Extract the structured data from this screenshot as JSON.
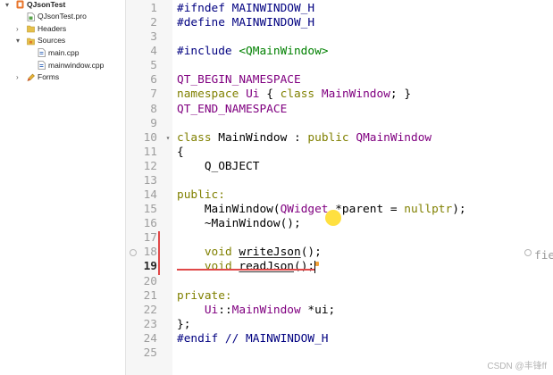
{
  "project_tree": {
    "items": [
      {
        "label": "QJsonTest",
        "depth": 0,
        "expander": "▾",
        "icon": "qt-project-icon",
        "bold": true
      },
      {
        "label": "QJsonTest.pro",
        "depth": 1,
        "icon": "pro-file-icon"
      },
      {
        "label": "Headers",
        "depth": 1,
        "expander": "›",
        "icon": "headers-folder-icon"
      },
      {
        "label": "Sources",
        "depth": 1,
        "expander": "▾",
        "icon": "sources-folder-icon"
      },
      {
        "label": "main.cpp",
        "depth": 2,
        "icon": "cpp-file-icon"
      },
      {
        "label": "mainwindow.cpp",
        "depth": 2,
        "icon": "cpp-file-icon"
      },
      {
        "label": "Forms",
        "depth": 1,
        "expander": "›",
        "icon": "forms-folder-icon"
      }
    ]
  },
  "editor": {
    "lines": [
      {
        "n": "1",
        "tokens": [
          {
            "t": "#ifndef MAINWINDOW_H",
            "color": "#000080"
          }
        ]
      },
      {
        "n": "2",
        "tokens": [
          {
            "t": "#define MAINWINDOW_H",
            "color": "#000080"
          }
        ]
      },
      {
        "n": "3",
        "tokens": []
      },
      {
        "n": "4",
        "tokens": [
          {
            "t": "#include ",
            "color": "#000080"
          },
          {
            "t": "<QMainWindow>",
            "color": "#008000"
          }
        ]
      },
      {
        "n": "5",
        "tokens": []
      },
      {
        "n": "6",
        "tokens": [
          {
            "t": "QT_BEGIN_NAMESPACE",
            "color": "#800080"
          }
        ]
      },
      {
        "n": "7",
        "tokens": [
          {
            "t": "namespace",
            "color": "#808000"
          },
          {
            "t": " "
          },
          {
            "t": "Ui",
            "color": "#800080"
          },
          {
            "t": " { "
          },
          {
            "t": "class",
            "color": "#808000"
          },
          {
            "t": " "
          },
          {
            "t": "MainWindow",
            "color": "#800080"
          },
          {
            "t": "; }"
          }
        ]
      },
      {
        "n": "8",
        "tokens": [
          {
            "t": "QT_END_NAMESPACE",
            "color": "#800080"
          }
        ]
      },
      {
        "n": "9",
        "tokens": []
      },
      {
        "n": "10",
        "fold": "▾",
        "tokens": [
          {
            "t": "class",
            "color": "#808000"
          },
          {
            "t": " MainWindow : "
          },
          {
            "t": "public",
            "color": "#808000"
          },
          {
            "t": " "
          },
          {
            "t": "QMainWindow",
            "color": "#800080"
          }
        ]
      },
      {
        "n": "11",
        "tokens": [
          {
            "t": "{"
          }
        ]
      },
      {
        "n": "12",
        "tokens": [
          {
            "t": "    Q_OBJECT"
          }
        ]
      },
      {
        "n": "13",
        "tokens": []
      },
      {
        "n": "14",
        "tokens": [
          {
            "t": "public:",
            "color": "#808000"
          }
        ]
      },
      {
        "n": "15",
        "tokens": [
          {
            "t": "    MainWindow("
          },
          {
            "t": "QWidget",
            "color": "#800080"
          },
          {
            "t": " *parent = "
          },
          {
            "t": "nullptr",
            "color": "#808000"
          },
          {
            "t": ");"
          }
        ]
      },
      {
        "n": "16",
        "tokens": [
          {
            "t": "    ~MainWindow();"
          }
        ]
      },
      {
        "n": "17",
        "changed": true,
        "tokens": []
      },
      {
        "n": "18",
        "changed": true,
        "bookmark": true,
        "tokens": [
          {
            "t": "    "
          },
          {
            "t": "void",
            "color": "#808000"
          },
          {
            "t": " "
          },
          {
            "t": "writeJson",
            "underline": true
          },
          {
            "t": "();"
          }
        ]
      },
      {
        "n": "19",
        "changed": true,
        "current": true,
        "tokens": [
          {
            "t": "    "
          },
          {
            "t": "void",
            "color": "#808000"
          },
          {
            "t": " "
          },
          {
            "t": "readJson",
            "underline": true
          },
          {
            "t": "();"
          }
        ]
      },
      {
        "n": "20",
        "tokens": []
      },
      {
        "n": "21",
        "tokens": [
          {
            "t": "private:",
            "color": "#808000"
          }
        ]
      },
      {
        "n": "22",
        "tokens": [
          {
            "t": "    "
          },
          {
            "t": "Ui",
            "color": "#800080"
          },
          {
            "t": "::"
          },
          {
            "t": "MainWindow",
            "color": "#800080"
          },
          {
            "t": " *ui;"
          }
        ]
      },
      {
        "n": "23",
        "tokens": [
          {
            "t": "};"
          }
        ]
      },
      {
        "n": "24",
        "tokens": [
          {
            "t": "#endif // MAINWINDOW_H",
            "color": "#000080"
          }
        ]
      },
      {
        "n": "25",
        "tokens": []
      }
    ],
    "inline_hint": {
      "text": "fie",
      "icon": "hint-circle-icon"
    }
  },
  "watermark": "CSDN @丰锋ff",
  "colors": {
    "change_marker": "#e04848",
    "gutter_bg": "#f6f6f6",
    "highlight": "#ffd600"
  }
}
